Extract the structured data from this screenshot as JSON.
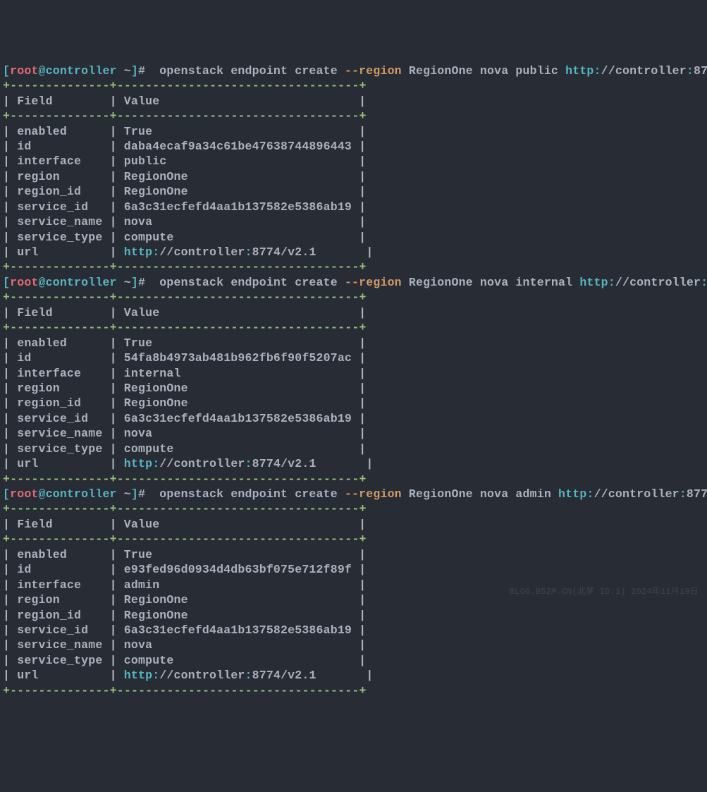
{
  "prompt": {
    "lbracket": "[",
    "user": "root",
    "at": "@",
    "host": "controller",
    "tilde": " ~",
    "rbracket": "]",
    "hash": "#  "
  },
  "cmd_prefix": "openstack endpoint create ",
  "option": "--region",
  "region_arg": " RegionOne nova ",
  "url_prefix": "//controller",
  "url_port": "8774/v2.1",
  "colon": ":",
  "http": "http",
  "commands": [
    {
      "iface": "public ",
      "id": "daba4ecaf9a34c61be47638744896443",
      "interface": "public  "
    },
    {
      "iface": "internal ",
      "id": "54fa8b4973ab481b962fb6f90f5207ac",
      "interface": "internal"
    },
    {
      "iface": "admin ",
      "id": "e93fed96d0934d4db63bf075e712f89f",
      "interface": "admin   "
    }
  ],
  "border_top": "+--------------+----------------------------------+",
  "header_field": "Field       ",
  "header_value": "Value                           ",
  "rows": {
    "enabled_label": "enabled     ",
    "enabled_val": "True                            ",
    "id_label": "id          ",
    "iface_label": "interface   ",
    "region_label": "region      ",
    "region_val": "RegionOne                       ",
    "regionid_label": "region_id   ",
    "regionid_val": "RegionOne                       ",
    "sid_label": "service_id  ",
    "sid_val": "6a3c31ecfefd4aa1b137582e5386ab19",
    "sname_label": "service_name",
    "sname_val": "nova                            ",
    "stype_label": "service_type",
    "stype_val": "compute                         ",
    "url_label": "url         ",
    "url_suffix_pad": "      "
  },
  "iface_pad": "                        ",
  "watermark": "BLOG.B52M.CN(北梦 ID:1) 2024年11月19日"
}
